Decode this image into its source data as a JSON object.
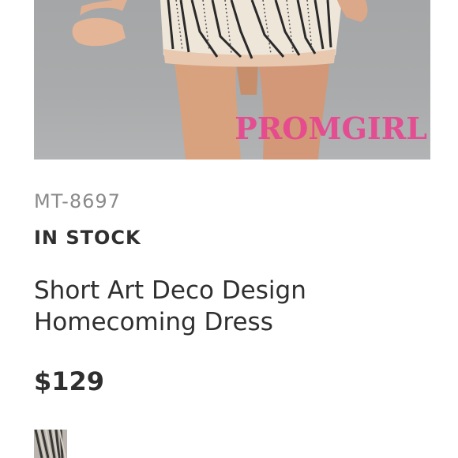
{
  "product": {
    "image_watermark": "PROMGIRL",
    "sku": "MT-8697",
    "stock_status": "IN STOCK",
    "title": "Short Art Deco Design Homecoming Dress",
    "price": "$129"
  },
  "colors": {
    "watermark_pink": "#e8458f",
    "sku_gray": "#8a8a8a",
    "text_dark": "#2f2f2f"
  }
}
